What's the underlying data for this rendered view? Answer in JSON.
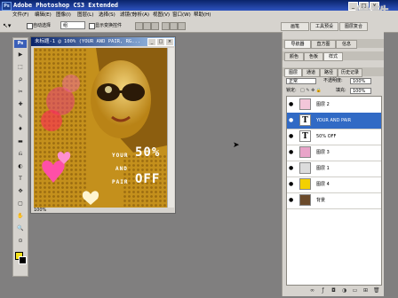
{
  "window": {
    "app_logo": "Ps",
    "title": "Adobe Photoshop CS3 Extended",
    "controls": [
      "_",
      "□",
      "×"
    ]
  },
  "watermark": "优酷",
  "menubar": [
    "文件(F)",
    "编辑(E)",
    "图像(I)",
    "图层(L)",
    "选择(S)",
    "滤镜(T)",
    "分析(A)",
    "视图(V)",
    "窗口(W)",
    "帮助(H)"
  ],
  "options": {
    "tool_preset_icon": "move-tool-icon",
    "auto_select_label": "自动选择",
    "auto_select_value": "组",
    "show_transform_label": "显示变换控件",
    "dock_tabs": [
      "画笔",
      "工具预设",
      "图层复合"
    ]
  },
  "toolbox": {
    "badge": "Ps",
    "tools": [
      "▶",
      "⬚",
      "ρ",
      "✂",
      "✚",
      "✎",
      "♦",
      "▬",
      "⎌",
      "◐",
      "T",
      "✥",
      "▢",
      "✋",
      "🔍",
      "⊙"
    ],
    "foreground_color": "#f5e21a",
    "background_color": "#000000"
  },
  "document": {
    "title": "未标题-1 @ 100% (YOUR AND PAIR, RG...",
    "controls": [
      "_",
      "□",
      "×"
    ],
    "zoom": "100%",
    "canvas_text": {
      "line1": "YOUR",
      "percent": "50%",
      "line2": "AND",
      "line3": "PAIR",
      "off": "OFF"
    }
  },
  "panels": {
    "top_tabs": [
      "导航器",
      "直方图",
      "信息"
    ],
    "mid_tabs": [
      "颜色",
      "色板",
      "样式"
    ],
    "layer_tabs": [
      "图层",
      "通道",
      "路径",
      "历史记录"
    ],
    "blend_mode": "正常",
    "opacity_label": "不透明度:",
    "opacity_value": "100%",
    "lock_label": "锁定:",
    "fill_label": "填充:",
    "fill_value": "100%"
  },
  "layers": [
    {
      "name": "图层 2",
      "thumb": "",
      "thumb_color": "#f3c6d9",
      "selected": false
    },
    {
      "name": "YOUR AND PAIR",
      "thumb": "T",
      "thumb_color": "#ffffff",
      "selected": true
    },
    {
      "name": "50%     OFF",
      "thumb": "T",
      "thumb_color": "#ffffff",
      "selected": false
    },
    {
      "name": "图层 3",
      "thumb": "",
      "thumb_color": "#e9a4c9",
      "selected": false
    },
    {
      "name": "图层 1",
      "thumb": "",
      "thumb_color": "#dcdcdc",
      "selected": false
    },
    {
      "name": "图层 4",
      "thumb": "",
      "thumb_color": "#f3d000",
      "selected": false
    },
    {
      "name": "背景",
      "thumb": "",
      "thumb_color": "#6b4a2a",
      "selected": false
    }
  ],
  "layer_footer_icons": [
    "link-icon",
    "fx-icon",
    "mask-icon",
    "adjustment-icon",
    "group-icon",
    "new-layer-icon",
    "trash-icon"
  ]
}
